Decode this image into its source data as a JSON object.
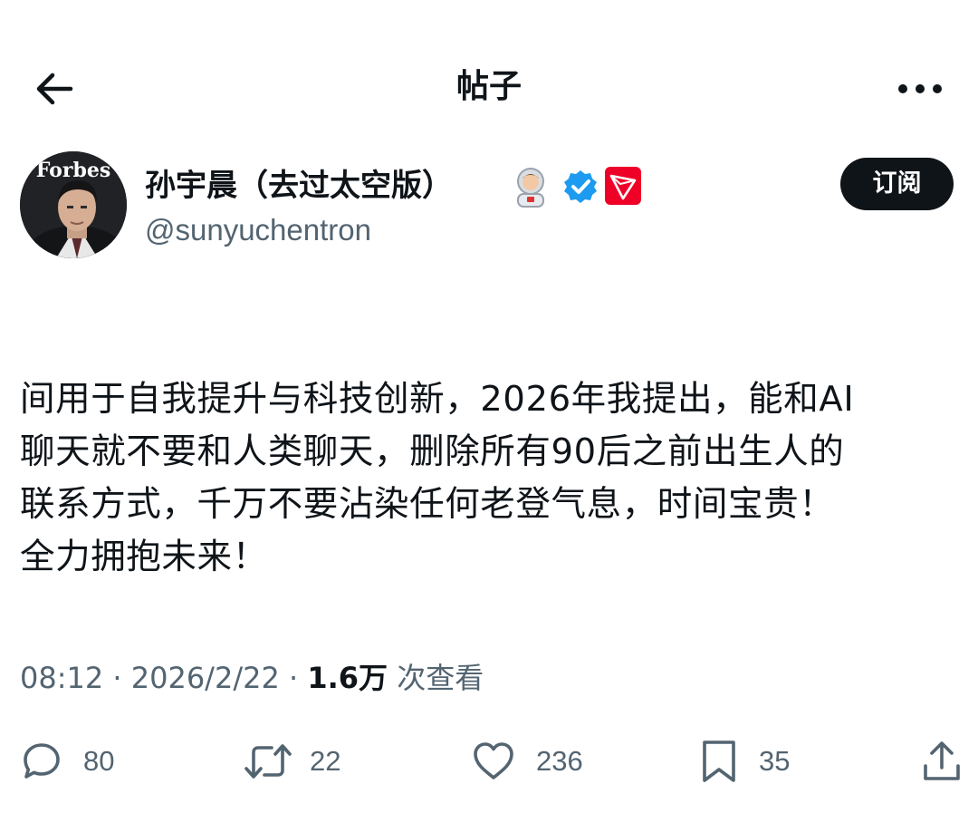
{
  "header": {
    "title": "帖子",
    "back_icon": "arrow-left-icon",
    "more_icon": "more-horizontal-icon"
  },
  "author": {
    "avatar_text": "Forbes",
    "display_name": "孙宇晨（去过太空版）",
    "handle": "@sunyuchentron",
    "badges": [
      "astronaut-emoji",
      "verified-badge-icon",
      "tron-logo-icon"
    ],
    "verified_color": "#1d9bf0",
    "tron_color": "#ef0027"
  },
  "subscribe_label": "订阅",
  "post": {
    "lines": [
      "间用于自我提升与科技创新，2026年我提出，能和AI",
      "聊天就不要和人类聊天，删除所有90后之前出生人的",
      "联系方式，千万不要沾染任何老登气息，时间宝贵！",
      "全力拥抱未来！"
    ]
  },
  "meta": {
    "time": "08:12",
    "separator": "·",
    "date": "2026/2/22",
    "views_count": "1.6万",
    "views_label": "次查看"
  },
  "actions": {
    "replies": "80",
    "reposts": "22",
    "likes": "236",
    "bookmarks": "35"
  },
  "colors": {
    "text": "#0f1419",
    "secondary": "#536471",
    "button_bg": "#0f1419"
  }
}
